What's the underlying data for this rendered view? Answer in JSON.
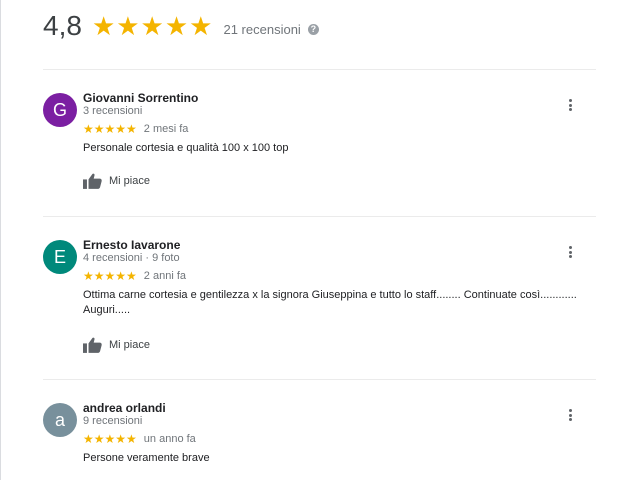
{
  "summary": {
    "score": "4,8",
    "stars": "★★★★★",
    "count_label": "21 recensioni",
    "help_icon": "question-circle-icon"
  },
  "colors": {
    "star": "#f4b400",
    "avatar_g": "#7b1fa2",
    "avatar_e": "#00897b",
    "avatar_a": "#78909c"
  },
  "reviews": [
    {
      "initial": "G",
      "name": "Giovanni Sorrentino",
      "meta": "3 recensioni",
      "stars": "★★★★★",
      "date": "2 mesi fa",
      "text": "Personale cortesia e qualità 100 x 100 top",
      "like_label": "Mi piace"
    },
    {
      "initial": "E",
      "name": "Ernesto Iavarone",
      "meta": "4 recensioni · 9 foto",
      "stars": "★★★★★",
      "date": "2 anni fa",
      "text": "Ottima carne cortesia e gentilezza x la signora Giuseppina e tutto lo staff........ Continuate così............ Auguri.....",
      "like_label": "Mi piace"
    },
    {
      "initial": "a",
      "name": "andrea orlandi",
      "meta": "9 recensioni",
      "stars": "★★★★★",
      "date": "un anno fa",
      "text": "Persone veramente brave"
    }
  ]
}
